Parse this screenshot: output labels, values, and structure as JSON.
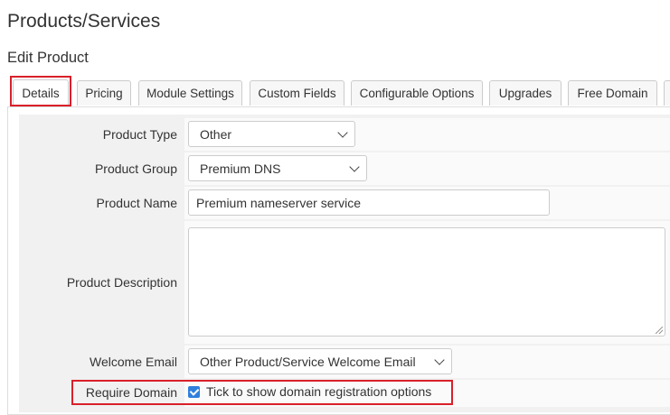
{
  "header": {
    "title": "Products/Services",
    "subtitle": "Edit Product"
  },
  "tabs": [
    {
      "label": "Details",
      "active": true
    },
    {
      "label": "Pricing"
    },
    {
      "label": "Module Settings"
    },
    {
      "label": "Custom Fields"
    },
    {
      "label": "Configurable Options"
    },
    {
      "label": "Upgrades"
    },
    {
      "label": "Free Domain"
    }
  ],
  "form": {
    "product_type": {
      "label": "Product Type",
      "value": "Other"
    },
    "product_group": {
      "label": "Product Group",
      "value": "Premium DNS"
    },
    "product_name": {
      "label": "Product Name",
      "value": "Premium nameserver service"
    },
    "product_description": {
      "label": "Product Description",
      "value": ""
    },
    "welcome_email": {
      "label": "Welcome Email",
      "value": "Other Product/Service Welcome Email"
    },
    "require_domain": {
      "label": "Require Domain",
      "checkbox_label": "Tick to show domain registration options",
      "checked": true
    }
  },
  "colors": {
    "highlight": "#d9202a",
    "checkbox": "#2f7fdc",
    "form_bg": "#f1f1f1"
  }
}
